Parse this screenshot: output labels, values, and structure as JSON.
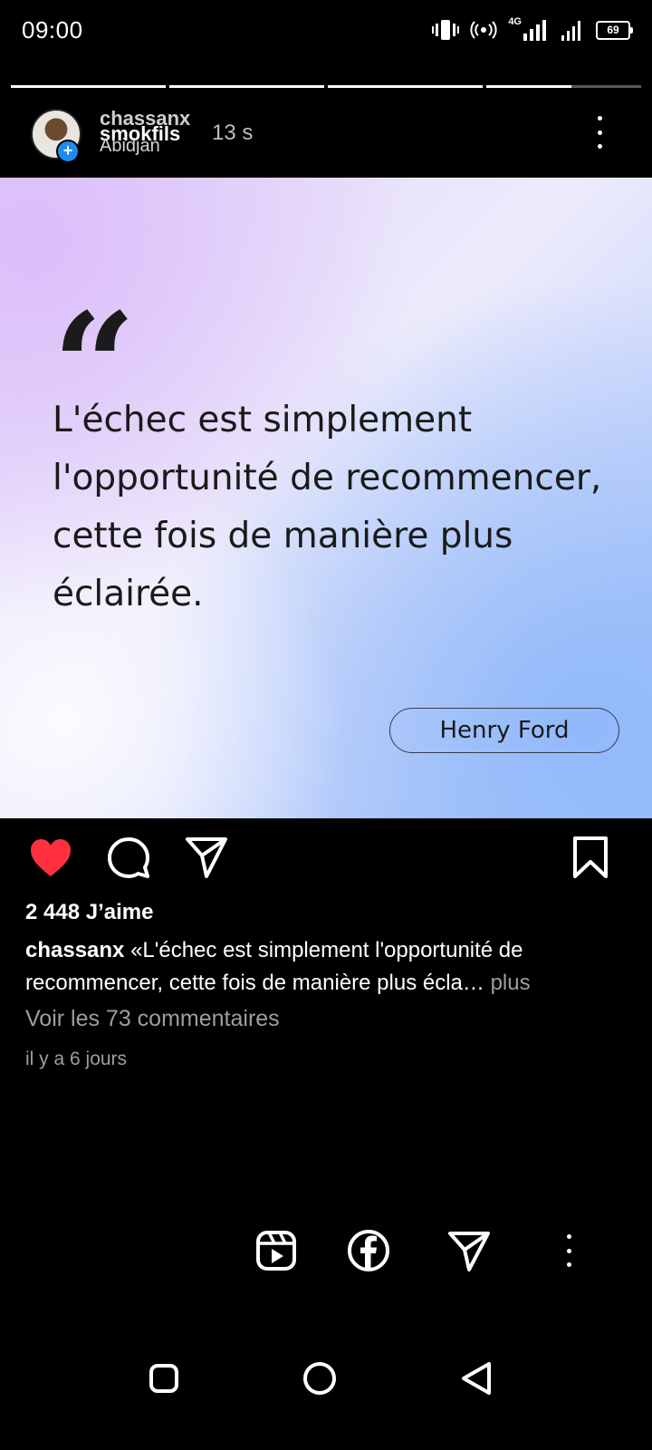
{
  "status_bar": {
    "time": "09:00",
    "network": "4G",
    "battery": "69",
    "icons": [
      "vibrate-icon",
      "hotspot-icon",
      "signal-icon",
      "battery-icon"
    ]
  },
  "story": {
    "progress_segments": [
      1,
      1,
      1,
      0.55
    ],
    "username_overlap_1": "chassanx",
    "username_overlap_2": "smokfils",
    "location": "Abidjan",
    "time_ago": "13 s"
  },
  "quote_card": {
    "quote_mark": "“",
    "text": "L'échec est simplement l'opportunité de recommencer, cette fois de manière plus éclairée.",
    "author": "Henry Ford"
  },
  "post": {
    "liked": true,
    "likes": "2 448 J’aime",
    "caption_user": "chassanx",
    "caption_text": "«L'échec est simplement l'opportunité de recommencer, cette fois de manière plus écla…",
    "caption_more": "plus",
    "comments_link": "Voir les 73 commentaires",
    "date": "il y a 6 jours"
  },
  "colors": {
    "heart": "#ff3040",
    "verified_blue": "#1d8bf1"
  }
}
